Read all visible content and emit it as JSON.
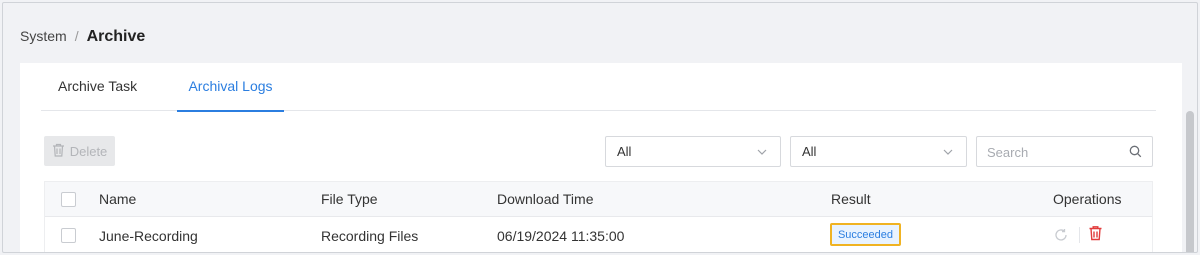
{
  "breadcrumb": {
    "parent": "System",
    "separator": "/",
    "current": "Archive"
  },
  "tabs": [
    {
      "label": "Archive Task",
      "active": false
    },
    {
      "label": "Archival Logs",
      "active": true
    }
  ],
  "toolbar": {
    "delete_label": "Delete",
    "filter1_value": "All",
    "filter2_value": "All",
    "search_placeholder": "Search"
  },
  "table": {
    "columns": [
      "Name",
      "File Type",
      "Download Time",
      "Result",
      "Operations"
    ],
    "rows": [
      {
        "name": "June-Recording",
        "file_type": "Recording Files",
        "download_time": "06/19/2024 11:35:00",
        "result": "Succeeded"
      }
    ]
  },
  "colors": {
    "accent": "#2b7ee0",
    "danger": "#e23b3b",
    "highlight": "#f0b323"
  },
  "icons": {
    "delete_button": "trash-icon",
    "dropdown": "chevron-down-icon",
    "search": "search-icon",
    "retry": "refresh-icon",
    "row_delete": "trash-icon"
  }
}
